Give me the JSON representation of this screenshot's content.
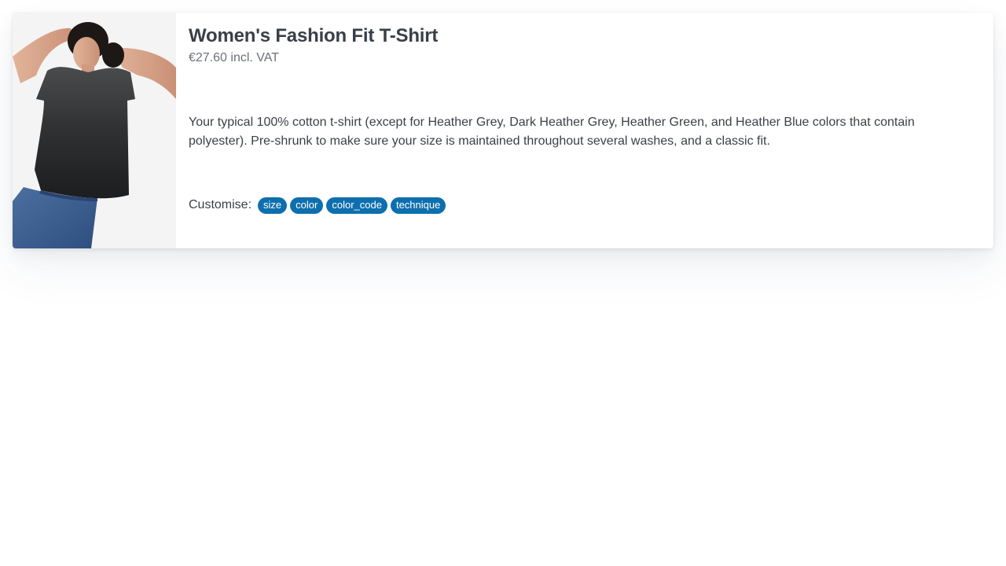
{
  "product": {
    "title": "Women's Fashion Fit T-Shirt",
    "price": "€27.60 incl. VAT",
    "description": "Your typical 100% cotton t-shirt (except for Heather Grey, Dark Heather Grey, Heather Green, and Heather Blue colors that contain polyester). Pre-shrunk to make sure your size is maintained throughout several washes, and a classic fit.",
    "image_icon": "product-photo",
    "customise": {
      "label": "Customise:",
      "options": [
        "size",
        "color",
        "color_code",
        "technique"
      ]
    }
  },
  "colors": {
    "tag_bg": "#0e6fae",
    "title": "#3a3f47",
    "price": "#6b717a"
  }
}
